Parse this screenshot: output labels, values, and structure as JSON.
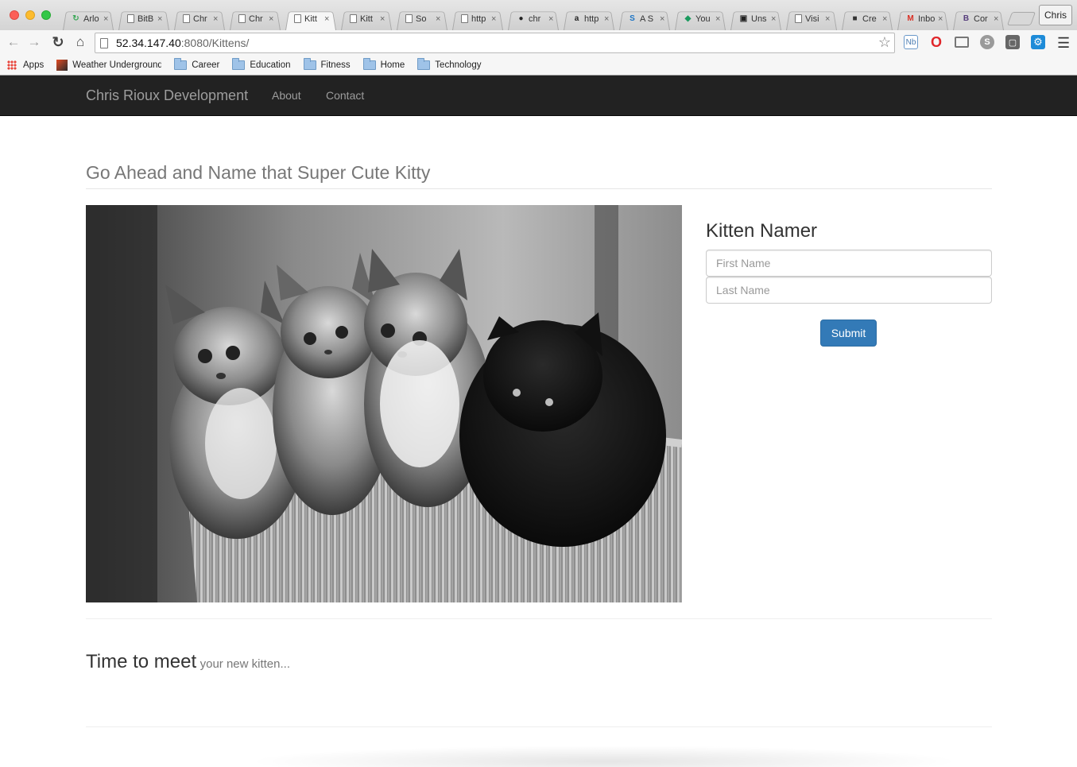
{
  "browser": {
    "tabs": [
      {
        "label": "Arlo",
        "icon": "refresh-green-icon"
      },
      {
        "label": "BitB",
        "icon": "document-icon"
      },
      {
        "label": "Chr",
        "icon": "document-icon"
      },
      {
        "label": "Chr",
        "icon": "document-icon"
      },
      {
        "label": "Kitt",
        "icon": "document-icon",
        "active": true
      },
      {
        "label": "Kitt",
        "icon": "document-icon"
      },
      {
        "label": "So",
        "icon": "document-icon"
      },
      {
        "label": "http",
        "icon": "document-icon"
      },
      {
        "label": "chr",
        "icon": "github-icon"
      },
      {
        "label": "http",
        "icon": "amazon-icon"
      },
      {
        "label": "A S",
        "icon": "s-blue-icon"
      },
      {
        "label": "You",
        "icon": "droplet-icon"
      },
      {
        "label": "Uns",
        "icon": "camera-icon"
      },
      {
        "label": "Visi",
        "icon": "document-icon"
      },
      {
        "label": "Cre",
        "icon": "cube-icon"
      },
      {
        "label": "Inbo",
        "icon": "gmail-icon"
      },
      {
        "label": "Cor",
        "icon": "bootstrap-icon"
      }
    ],
    "profile_name": "Chris",
    "url_host": "52.34.147.40",
    "url_rest": ":8080/Kittens/",
    "bookmarks": {
      "apps": "Apps",
      "weather": "Weather Underground",
      "career": "Career",
      "education": "Education",
      "fitness": "Fitness",
      "home": "Home",
      "technology": "Technology"
    }
  },
  "site": {
    "brand": "Chris Rioux Development",
    "nav": {
      "about": "About",
      "contact": "Contact"
    },
    "page_title": "Go Ahead and Name that Super Cute Kitty",
    "namer": {
      "heading": "Kitten Namer",
      "first_name_placeholder": "First Name",
      "last_name_placeholder": "Last Name",
      "submit_label": "Submit"
    },
    "meet": {
      "big": "Time to meet",
      "small": "your new kitten..."
    }
  }
}
